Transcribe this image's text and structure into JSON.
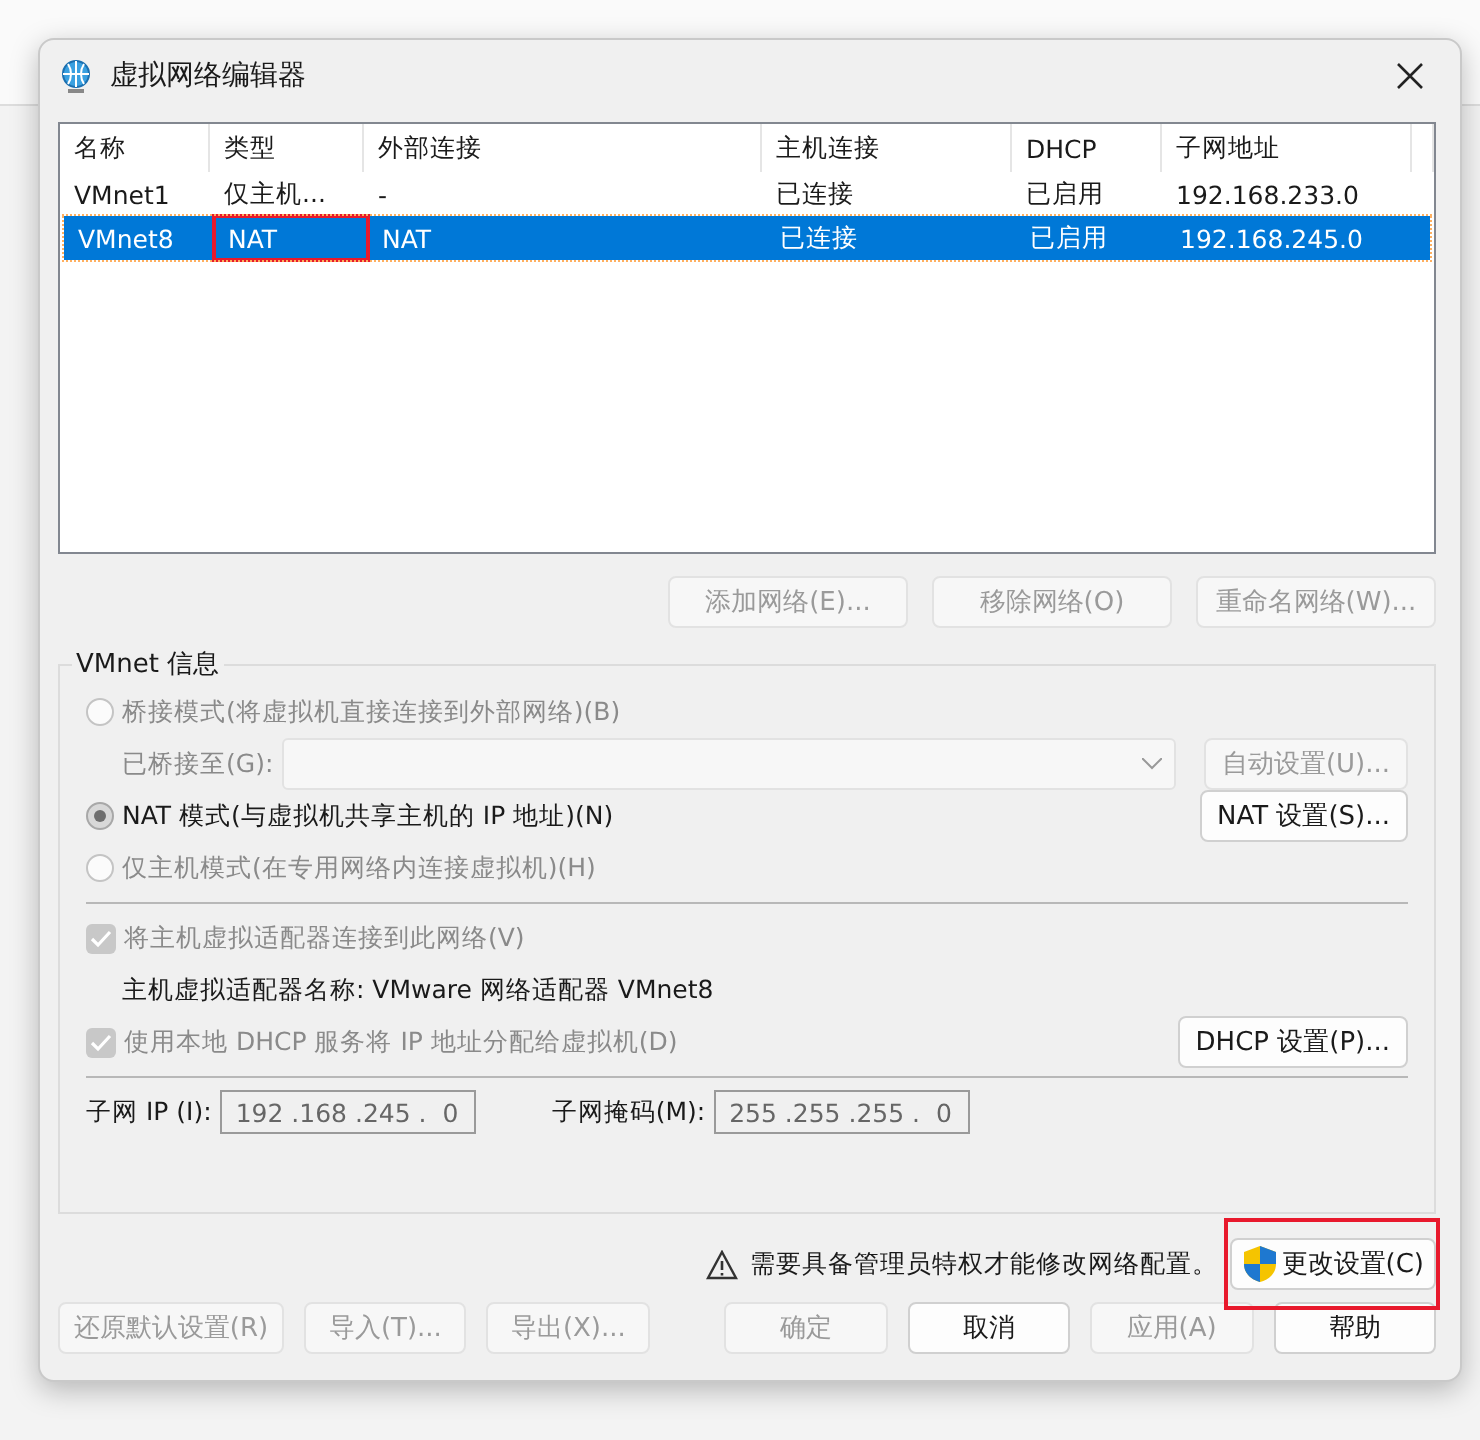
{
  "window": {
    "title": "虚拟网络编辑器"
  },
  "table": {
    "columns": [
      "名称",
      "类型",
      "外部连接",
      "主机连接",
      "DHCP",
      "子网地址"
    ],
    "rows": [
      {
        "cells": [
          {
            "text": "VMnet1",
            "outlined": false
          },
          {
            "text": "仅主机...",
            "outlined": false
          },
          {
            "text": "-",
            "outlined": false
          },
          {
            "text": "已连接",
            "outlined": false
          },
          {
            "text": "已启用",
            "outlined": false
          },
          {
            "text": "192.168.233.0",
            "outlined": false
          }
        ],
        "selected": false
      },
      {
        "cells": [
          {
            "text": "VMnet8",
            "outlined": false
          },
          {
            "text": "NAT",
            "outlined": true
          },
          {
            "text": "NAT",
            "outlined": false
          },
          {
            "text": "已连接",
            "outlined": false
          },
          {
            "text": "已启用",
            "outlined": false
          },
          {
            "text": "192.168.245.0",
            "outlined": false
          }
        ],
        "selected": true
      }
    ]
  },
  "list_buttons": [
    {
      "label": "添加网络(E)...",
      "disabled": true
    },
    {
      "label": "移除网络(O)",
      "disabled": true
    },
    {
      "label": "重命名网络(W)...",
      "disabled": true
    }
  ],
  "vmnet_info": {
    "title": "VMnet 信息",
    "modes": [
      {
        "label": "桥接模式(将虚拟机直接连接到外部网络)(B)",
        "selected": false
      },
      {
        "label": "NAT 模式(与虚拟机共享主机的 IP 地址)(N)",
        "selected": true,
        "button": "NAT 设置(S)..."
      },
      {
        "label": "仅主机模式(在专用网络内连接虚拟机)(H)",
        "selected": false
      }
    ],
    "bridged_to": {
      "label": "已桥接至(G):",
      "button": "自动设置(U)..."
    },
    "connect_adapter": {
      "label": "将主机虚拟适配器连接到此网络(V)",
      "checked": true,
      "disabled": true
    },
    "adapter_name": "主机虚拟适配器名称: VMware 网络适配器 VMnet8",
    "use_dhcp": {
      "label": "使用本地 DHCP 服务将 IP 地址分配给虚拟机(D)",
      "checked": true,
      "disabled": true,
      "button": "DHCP 设置(P)..."
    },
    "subnet_ip": {
      "label": "子网 IP (I):",
      "value": "192 .168 .245 .  0"
    },
    "subnet_mask": {
      "label": "子网掩码(M):",
      "value": "255 .255 .255 .  0"
    }
  },
  "warning": {
    "text": "需要具备管理员特权才能修改网络配置。",
    "button": "更改设置(C)",
    "outlined": true
  },
  "footer_buttons": [
    {
      "label": "还原默认设置(R)",
      "disabled": true
    },
    {
      "label": "导入(T)...",
      "disabled": true
    },
    {
      "label": "导出(X)...",
      "disabled": true
    },
    {
      "label": "确定",
      "disabled": true
    },
    {
      "label": "取消",
      "disabled": false
    },
    {
      "label": "应用(A)",
      "disabled": true
    },
    {
      "label": "帮助",
      "disabled": false
    }
  ]
}
